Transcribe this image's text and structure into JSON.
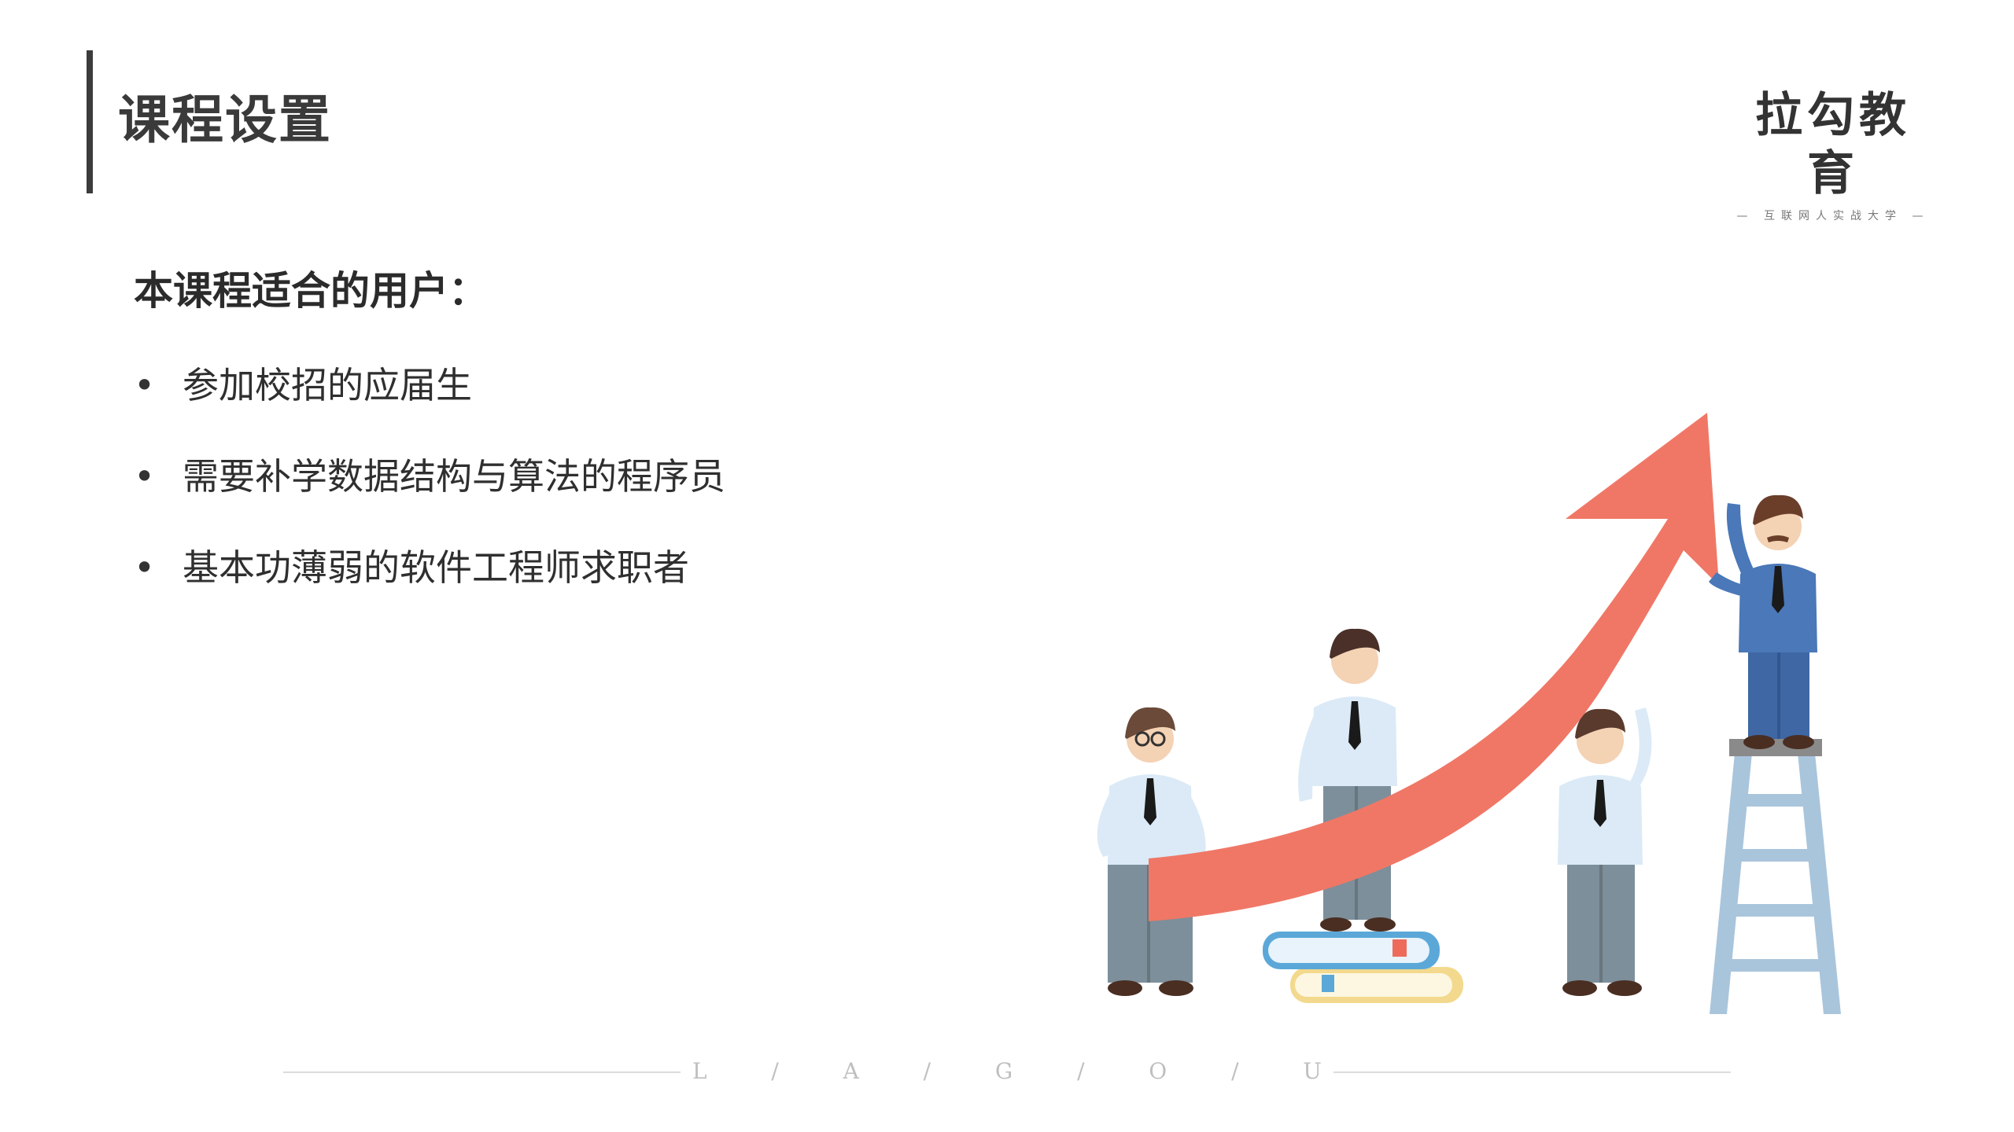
{
  "slide": {
    "title": "课程设置",
    "logo": {
      "main": "拉勾教育",
      "sub": "— 互联网人实战大学 —"
    },
    "subheading": "本课程适合的用户：",
    "bullets": [
      {
        "marker": "•",
        "text": "参加校招的应届生"
      },
      {
        "marker": "•",
        "text": "需要补学数据结构与算法的程序员"
      },
      {
        "marker": "•",
        "text": "基本功薄弱的软件工程师求职者"
      }
    ],
    "footer": [
      "L",
      "/",
      "A",
      "/",
      "G",
      "/",
      "O",
      "/",
      "U"
    ]
  },
  "colors": {
    "arrow": "#f07766",
    "shirt": "#dbeaf6",
    "suit": "#4a78b8",
    "pants": "#7d8f9a",
    "ladder": "#a9c5dc"
  }
}
